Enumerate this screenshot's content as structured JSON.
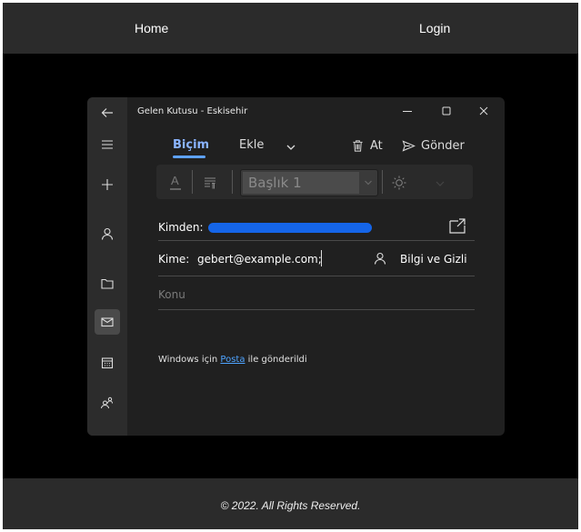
{
  "site": {
    "nav_home": "Home",
    "nav_login": "Login",
    "footer": "© 2022. All Rights Reserved."
  },
  "window": {
    "title": "Gelen Kutusu - Eskisehir"
  },
  "tabs": [
    {
      "label": "Biçim",
      "active": true
    },
    {
      "label": "Ekle",
      "active": false
    }
  ],
  "toolbar": {
    "discard_label": "At",
    "send_label": "Gönder"
  },
  "format": {
    "style_value": "Başlık 1"
  },
  "compose": {
    "from_label": "Kimden:",
    "to_label": "Kime:",
    "to_value": "gebert@example.com;",
    "cc_bcc_label": "Bilgi ve Gizli",
    "subject_placeholder": "Konu",
    "signature_prefix": "Windows için",
    "signature_link": "Posta",
    "signature_suffix": "ile gönderildi"
  },
  "colors": {
    "accent": "#5ea2ff",
    "redaction": "#1565e8",
    "window_bg": "#202020",
    "rail_bg": "#2c2c2c"
  },
  "icons": {
    "rail": [
      "back-arrow-icon",
      "hamburger-menu-icon",
      "plus-icon",
      "person-icon",
      "folder-icon",
      "mail-icon",
      "calendar-icon",
      "people-icon"
    ]
  }
}
